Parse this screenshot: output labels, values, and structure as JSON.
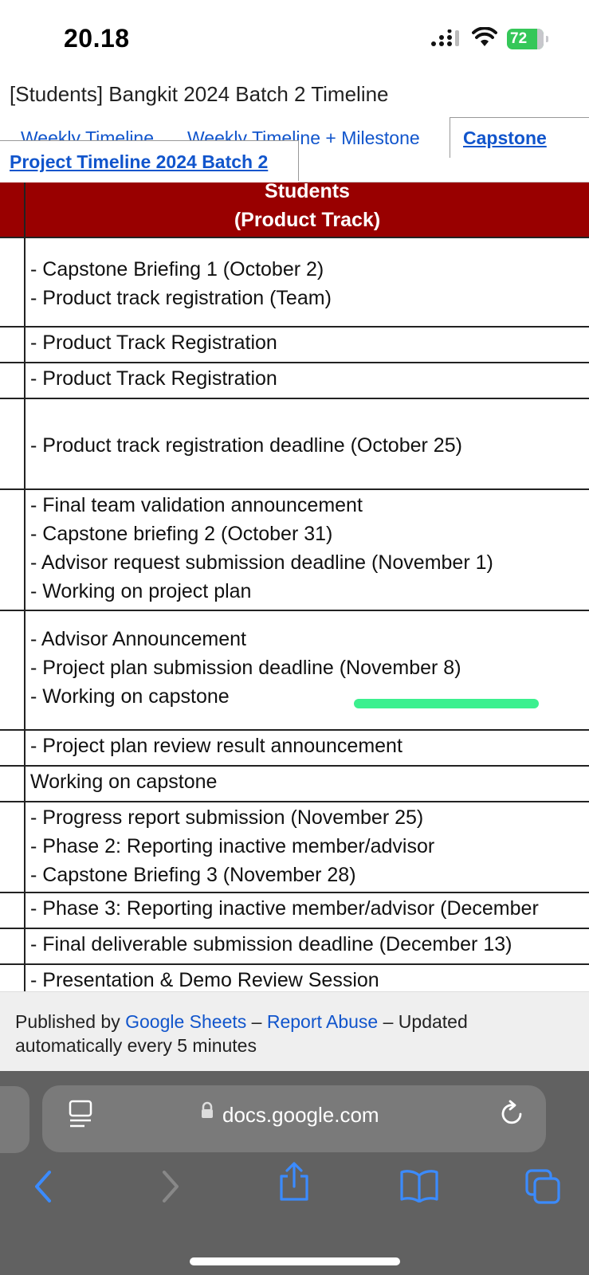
{
  "status_bar": {
    "time": "20.18",
    "battery": "72"
  },
  "document": {
    "title": "[Students] Bangkit 2024 Batch 2 Timeline"
  },
  "tabs": {
    "weekly": "Weekly Timeline",
    "weekly_milestone": "Weekly Timeline + Milestone",
    "active_line1": "Capstone",
    "active_line2": "Project Timeline 2024 Batch 2"
  },
  "table": {
    "header_line1": "Students",
    "header_line2": "(Product Track)",
    "rows": [
      {
        "lines": [
          "- Capstone Briefing 1 (October 2)",
          "- Product track registration (Team)"
        ]
      },
      {
        "lines": [
          "- Product Track Registration"
        ]
      },
      {
        "lines": [
          "- Product Track Registration"
        ]
      },
      {
        "lines": [
          "- Product track registration deadline (October 25)"
        ]
      },
      {
        "lines": [
          "- Final team validation announcement",
          "- Capstone briefing 2 (October 31)",
          "- Advisor request submission deadline (November 1)",
          "- Working on project plan"
        ]
      },
      {
        "lines": [
          "- Advisor Announcement",
          "- Project plan submission deadline (November 8)",
          "- Working on capstone"
        ]
      },
      {
        "lines": [
          "- Project plan review result announcement"
        ]
      },
      {
        "lines": [
          "Working on capstone"
        ]
      },
      {
        "lines": [
          "- Progress report submission (November 25)",
          "- Phase 2: Reporting inactive member/advisor",
          "- Capstone Briefing 3 (November 28)"
        ]
      },
      {
        "lines": [
          "- Phase 3: Reporting inactive member/advisor (December"
        ]
      },
      {
        "lines": [
          "- Final deliverable submission deadline (December 13)"
        ]
      },
      {
        "lines": [
          "- Presentation & Demo Review Session"
        ]
      }
    ]
  },
  "footer": {
    "published_by": "Published by ",
    "google_sheets": "Google Sheets",
    "dash1": " – ",
    "report_abuse": "Report Abuse",
    "updated": " – Updated automatically every 5 minutes"
  },
  "browser": {
    "url": "docs.google.com"
  },
  "colors": {
    "header_bg": "#990000",
    "link": "#1155cc",
    "highlight": "#3cf08f"
  }
}
